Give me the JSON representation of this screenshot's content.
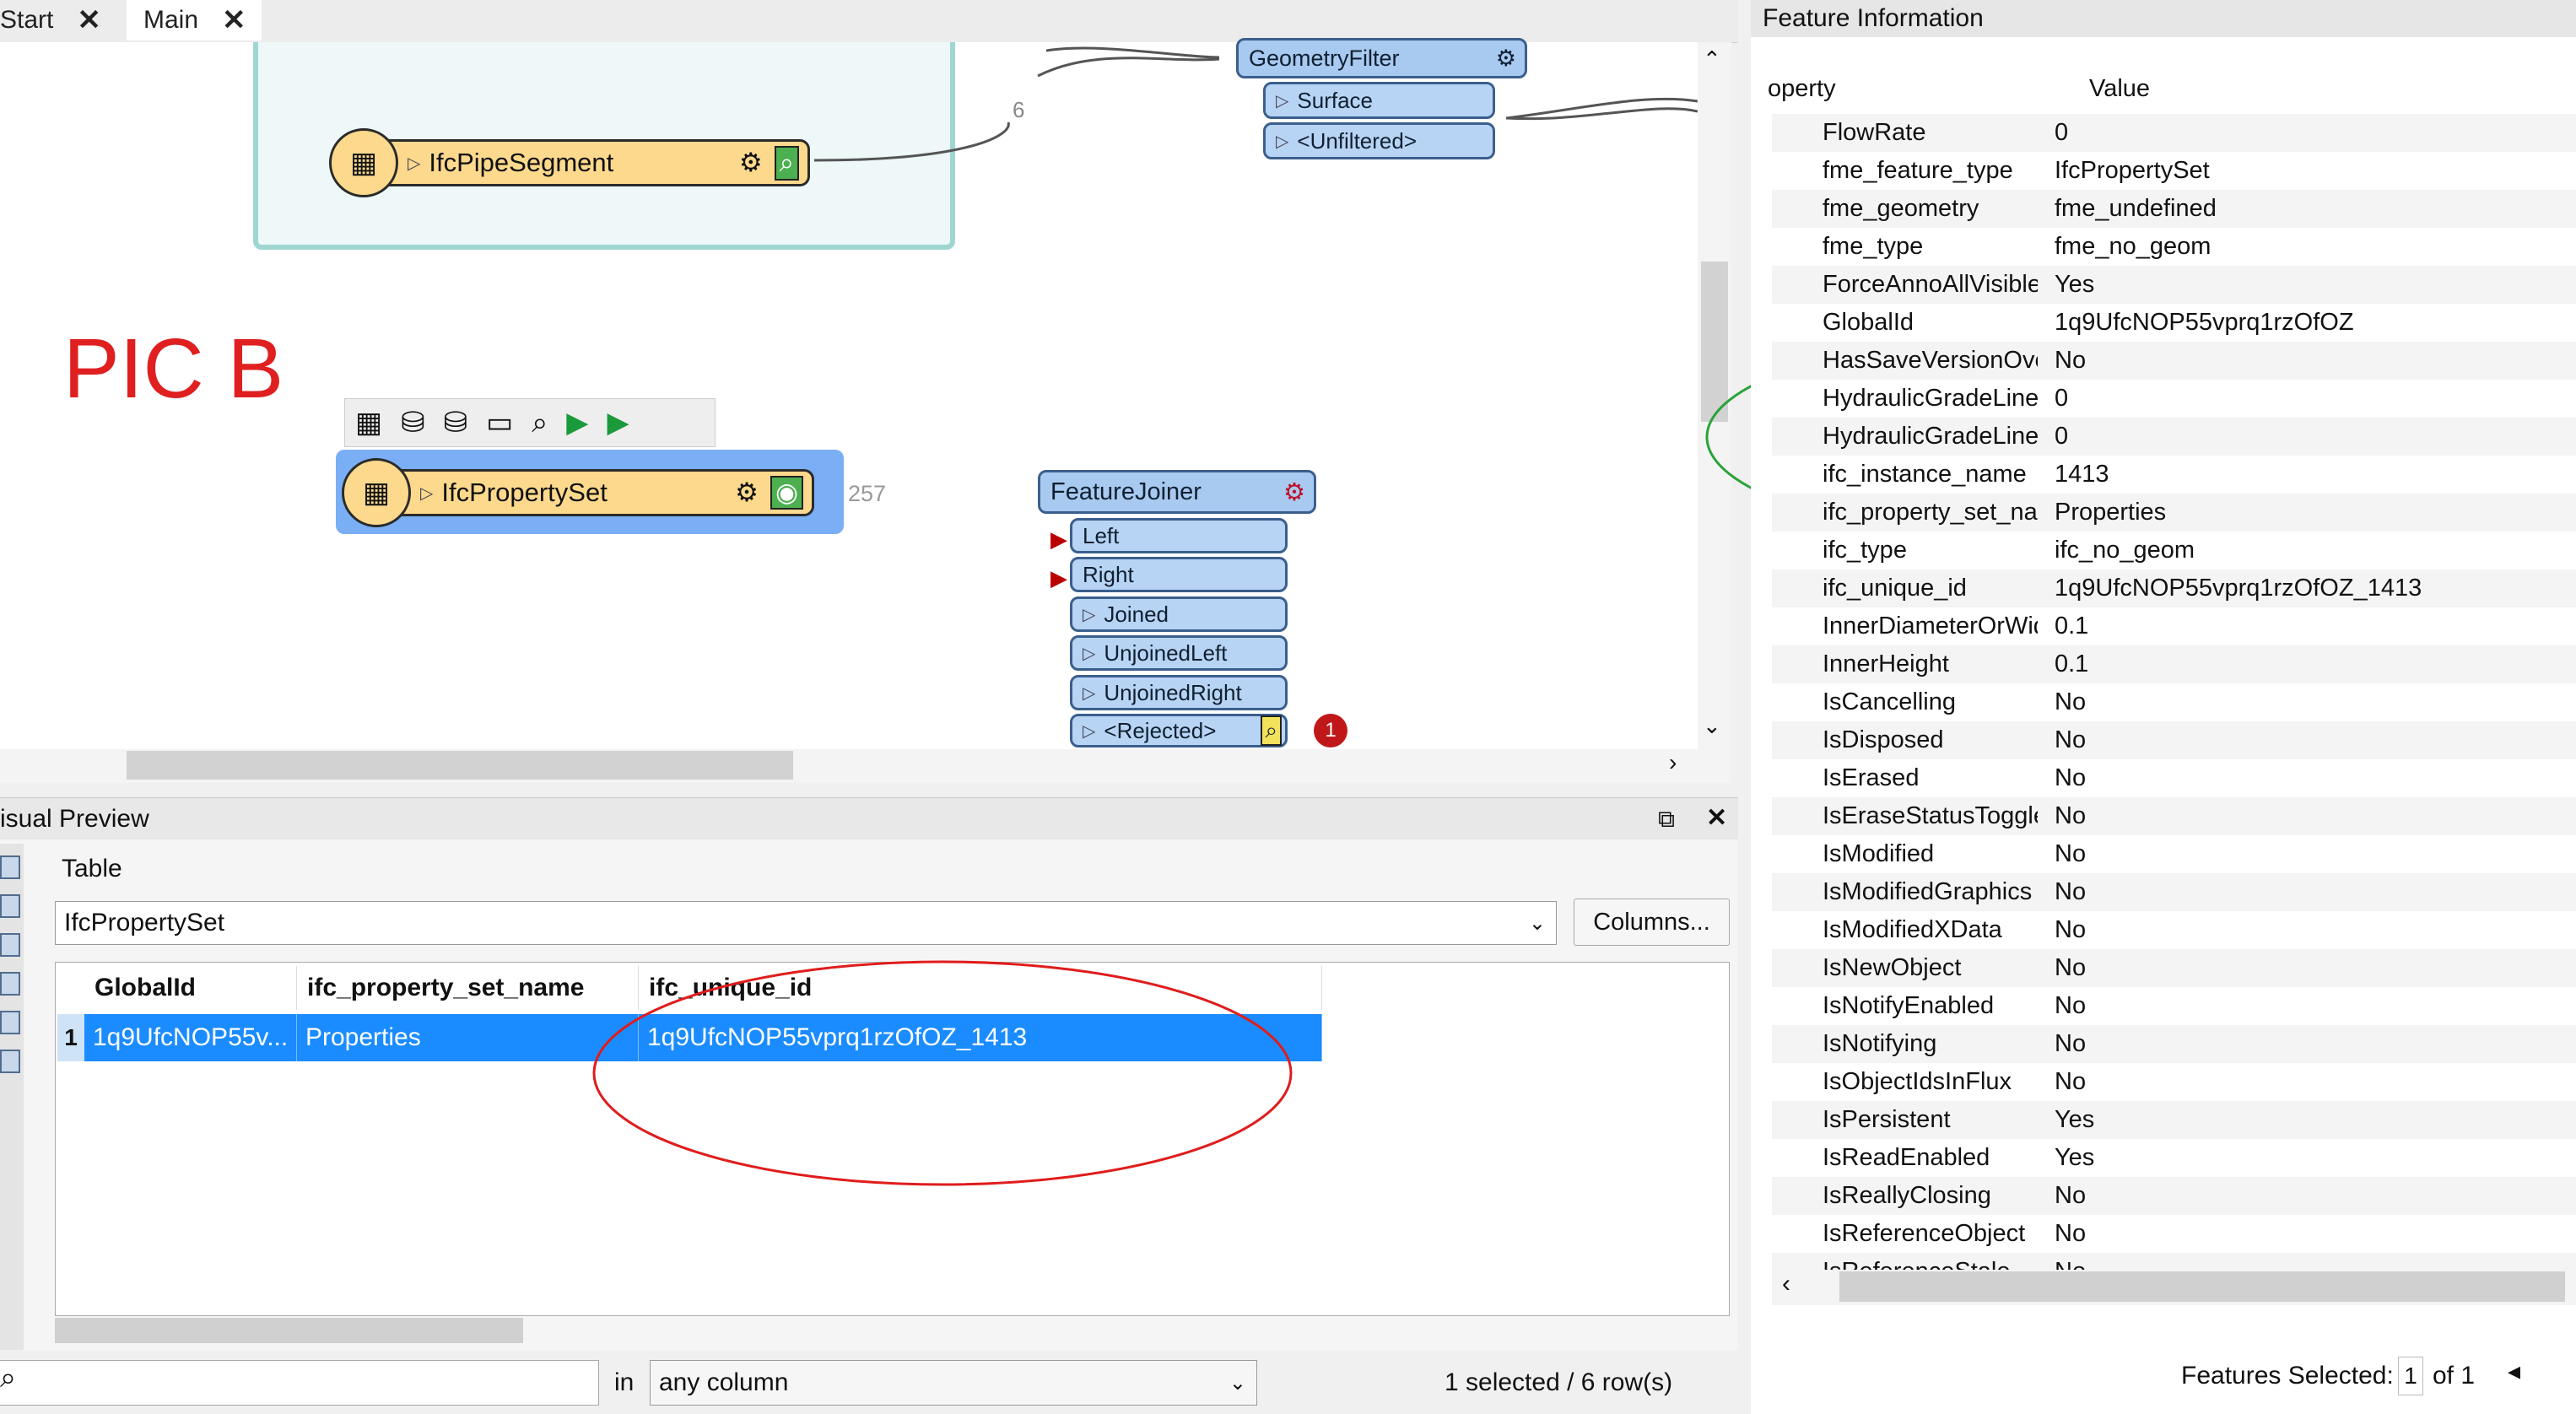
{
  "tabs": [
    {
      "label": "Start"
    },
    {
      "label": "Main"
    }
  ],
  "annotation": {
    "label": "PIC B"
  },
  "canvas": {
    "pipe_segment": {
      "label": "IfcPipeSegment",
      "count": "6"
    },
    "property_set": {
      "label": "IfcPropertySet",
      "count": "257"
    },
    "geometry_filter": {
      "label": "GeometryFilter",
      "ports": [
        "Surface",
        "<Unfiltered>"
      ]
    },
    "feature_joiner": {
      "label": "FeatureJoiner",
      "inputs": [
        "Left",
        "Right"
      ],
      "outputs": [
        "Joined",
        "UnjoinedLeft",
        "UnjoinedRight",
        "<Rejected>"
      ],
      "badge": "1"
    }
  },
  "visual_preview": {
    "title": "isual Preview",
    "view_label": "Table",
    "dataset": "IfcPropertySet",
    "columns_button": "Columns...",
    "headers": [
      "GlobalId",
      "ifc_property_set_name",
      "ifc_unique_id"
    ],
    "rows": [
      {
        "num": "1",
        "cells": [
          "1q9UfcNOP55v...",
          "Properties",
          "1q9UfcNOP55vprq1rzOfOZ_1413"
        ]
      }
    ],
    "search_in_label": "in",
    "search_scope": "any column",
    "status": "1 selected / 6 row(s)"
  },
  "feature_info": {
    "title": "Feature Information",
    "header_property": "operty",
    "header_value": "Value",
    "rows": [
      {
        "k": "FlowRate",
        "v": "0"
      },
      {
        "k": "fme_feature_type",
        "v": "IfcPropertySet"
      },
      {
        "k": "fme_geometry",
        "v": "fme_undefined"
      },
      {
        "k": "fme_type",
        "v": "fme_no_geom"
      },
      {
        "k": "ForceAnnoAllVisible",
        "v": "Yes"
      },
      {
        "k": "GlobalId",
        "v": "1q9UfcNOP55vprq1rzOfOZ"
      },
      {
        "k": "HasSaveVersionOver...",
        "v": "No"
      },
      {
        "k": "HydraulicGradeLine...",
        "v": "0"
      },
      {
        "k": "HydraulicGradeLineUp",
        "v": "0"
      },
      {
        "k": "ifc_instance_name",
        "v": "1413"
      },
      {
        "k": "ifc_property_set_name",
        "v": "Properties"
      },
      {
        "k": "ifc_type",
        "v": "ifc_no_geom"
      },
      {
        "k": "ifc_unique_id",
        "v": "1q9UfcNOP55vprq1rzOfOZ_1413"
      },
      {
        "k": "InnerDiameterOrWid...",
        "v": "0.1"
      },
      {
        "k": "InnerHeight",
        "v": "0.1"
      },
      {
        "k": "IsCancelling",
        "v": "No"
      },
      {
        "k": "IsDisposed",
        "v": "No"
      },
      {
        "k": "IsErased",
        "v": "No"
      },
      {
        "k": "IsEraseStatusToggled",
        "v": "No"
      },
      {
        "k": "IsModified",
        "v": "No"
      },
      {
        "k": "IsModifiedGraphics",
        "v": "No"
      },
      {
        "k": "IsModifiedXData",
        "v": "No"
      },
      {
        "k": "IsNewObject",
        "v": "No"
      },
      {
        "k": "IsNotifyEnabled",
        "v": "No"
      },
      {
        "k": "IsNotifying",
        "v": "No"
      },
      {
        "k": "IsObjectIdsInFlux",
        "v": "No"
      },
      {
        "k": "IsPersistent",
        "v": "Yes"
      },
      {
        "k": "IsReadEnabled",
        "v": "Yes"
      },
      {
        "k": "IsReallyClosing",
        "v": "No"
      },
      {
        "k": "IsReferenceObject",
        "v": "No"
      },
      {
        "k": "IsReferenceStale",
        "v": "No"
      }
    ],
    "features_selected_label": "Features Selected:",
    "features_selected_value": "1",
    "features_of": "of 1"
  }
}
